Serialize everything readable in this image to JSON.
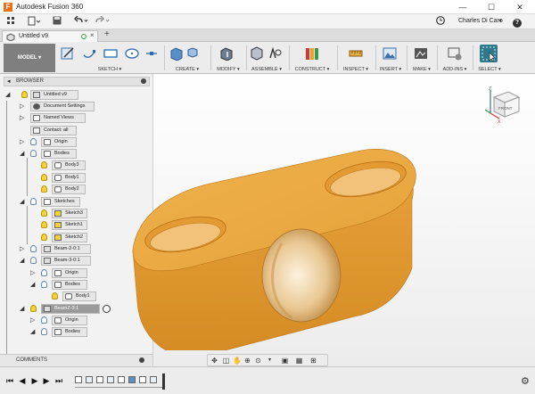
{
  "app": {
    "title": "Autodesk Fusion 360",
    "logo": "F",
    "user": "Charles Di Caro",
    "help": "?"
  },
  "window_controls": {
    "minimize": "—",
    "maximize": "☐",
    "close": "✕"
  },
  "document_tab": {
    "label": "Untitled v9",
    "close": "×",
    "add": "+"
  },
  "workspace": {
    "label": "MODEL ▾"
  },
  "ribbon_groups": [
    {
      "label": "SKETCH ▾"
    },
    {
      "label": "CREATE ▾"
    },
    {
      "label": "MODIFY ▾"
    },
    {
      "label": "ASSEMBLE ▾"
    },
    {
      "label": "CONSTRUCT ▾"
    },
    {
      "label": "INSPECT ▾"
    },
    {
      "label": "INSERT ▾"
    },
    {
      "label": "MAKE ▾"
    },
    {
      "label": "ADD-INS ▾"
    },
    {
      "label": "SELECT ▾"
    }
  ],
  "browser": {
    "title": "BROWSER",
    "items": [
      {
        "label": "Untitled v9"
      },
      {
        "label": "Document Settings"
      },
      {
        "label": "Named Views"
      },
      {
        "label": "Contact: all"
      },
      {
        "label": "Origin"
      },
      {
        "label": "Bodies"
      },
      {
        "label": "Body3"
      },
      {
        "label": "Body1"
      },
      {
        "label": "Body2"
      },
      {
        "label": "Sketches"
      },
      {
        "label": "Sketch3"
      },
      {
        "label": "Sketch1"
      },
      {
        "label": "Sketch2"
      },
      {
        "label": "Beam-2-0:1"
      },
      {
        "label": "Beam-3-0:1"
      },
      {
        "label": "Origin"
      },
      {
        "label": "Bodies"
      },
      {
        "label": "Body1"
      },
      {
        "label": "BeamZ-3:1"
      },
      {
        "label": "Origin"
      },
      {
        "label": "Bodies"
      }
    ]
  },
  "comments": {
    "label": "COMMENTS"
  },
  "viewcube": {
    "label": "FRONT",
    "axis_z": "Z",
    "axis_x": "X"
  },
  "colors": {
    "part": "#e8a33c",
    "accent": "#e8701a"
  }
}
